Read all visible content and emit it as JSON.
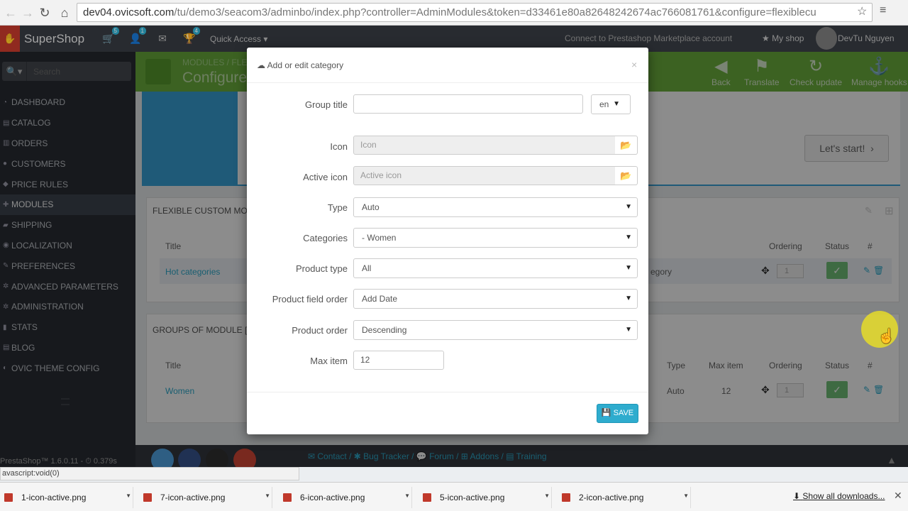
{
  "browser": {
    "url_host": "dev04.ovicsoft.com",
    "url_path": "/tu/demo3/seacom3/adminbo/index.php?controller=AdminModules&token=d33461e80a82648242674ac766081761&configure=flexiblecu"
  },
  "header": {
    "shop_name": "SuperShop",
    "badges": {
      "orders": "5",
      "customers": "1",
      "achievements": "4"
    },
    "quick_access": "Quick Access ▾",
    "connect": "Connect to Prestashop Marketplace account",
    "my_shop": "My shop",
    "username": "DevTu Nguyen"
  },
  "sidebar": {
    "search_placeholder": "Search",
    "items": [
      {
        "label": "DASHBOARD"
      },
      {
        "label": "CATALOG"
      },
      {
        "label": "ORDERS"
      },
      {
        "label": "CUSTOMERS"
      },
      {
        "label": "PRICE RULES"
      },
      {
        "label": "MODULES"
      },
      {
        "label": "SHIPPING"
      },
      {
        "label": "LOCALIZATION"
      },
      {
        "label": "PREFERENCES"
      },
      {
        "label": "ADVANCED PARAMETERS"
      },
      {
        "label": "ADMINISTRATION"
      },
      {
        "label": "STATS"
      },
      {
        "label": "BLOG"
      },
      {
        "label": "OVIC THEME CONFIG"
      }
    ]
  },
  "toolbar": {
    "breadcrumb": "MODULES",
    "breadcrumb_2": "FLE",
    "title": "Configure",
    "buttons": [
      "Back",
      "Translate",
      "Check update",
      "Manage hooks"
    ]
  },
  "content": {
    "lets_start": "Let's start!",
    "panel1": {
      "heading": "FLEXIBLE CUSTOM MODULE",
      "col_title": "Title",
      "col_ordering": "Ordering",
      "col_status": "Status",
      "col_hash": "#",
      "row_title": "Hot categories",
      "row_type": "egory",
      "row_order": "1"
    },
    "panel2": {
      "heading": "GROUPS OF MODULE [HOT",
      "col_title": "Title",
      "col_type": "Type",
      "col_maxitem": "Max item",
      "col_ordering": "Ordering",
      "col_status": "Status",
      "col_hash": "#",
      "row_title": "Women",
      "row_type": "Auto",
      "row_maxitem": "12",
      "row_order": "1"
    }
  },
  "footer": {
    "version": "PrestaShop™ 1.6.0.11 - ⏱ 0.379s",
    "links": "✉ Contact / ✱ Bug Tracker / 💬 Forum / ⊞ Addons / ▤ Training"
  },
  "modal": {
    "title": "Add or edit category",
    "fields": {
      "group_title_label": "Group title",
      "group_title_value": "",
      "lang": "en",
      "icon_label": "Icon",
      "icon_placeholder": "Icon",
      "active_icon_label": "Active icon",
      "active_icon_placeholder": "Active icon",
      "type_label": "Type",
      "type_value": "Auto",
      "categories_label": "Categories",
      "categories_value": "- Women",
      "product_type_label": "Product type",
      "product_type_value": "All",
      "product_field_order_label": "Product field order",
      "product_field_order_value": "Add Date",
      "product_order_label": "Product order",
      "product_order_value": "Descending",
      "max_item_label": "Max item",
      "max_item_value": "12"
    },
    "save_label": "SAVE"
  },
  "statusbar": "avascript:void(0)",
  "downloads": {
    "items": [
      "1-icon-active.png",
      "7-icon-active.png",
      "6-icon-active.png",
      "5-icon-active.png",
      "2-icon-active.png"
    ],
    "show_all": "Show all downloads..."
  },
  "colors": {
    "accent": "#2eacce",
    "toolbar_green": "#6db33f",
    "sidebar": "#2b2f35",
    "status_green": "#72c279"
  }
}
